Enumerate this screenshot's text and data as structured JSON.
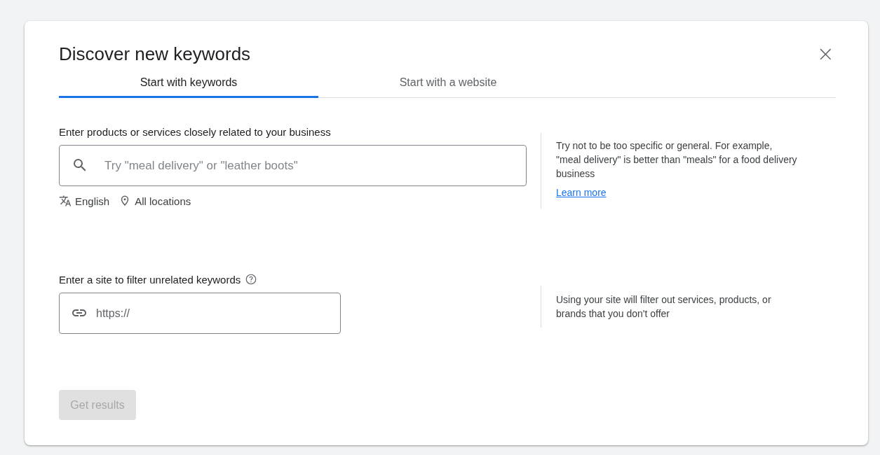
{
  "dialog": {
    "title": "Discover new keywords",
    "close": "×"
  },
  "tabs": [
    {
      "label": "Start with keywords",
      "selected": true
    },
    {
      "label": "Start with a website",
      "selected": false
    }
  ],
  "keywords_section": {
    "label": "Enter products or services closely related to your business",
    "placeholder": "Try \"meal delivery\" or \"leather boots\"",
    "language": "English",
    "location": "All locations",
    "hint": "Try not to be too specific or general. For example, \"meal delivery\" is better than \"meals\" for a food delivery business",
    "link": "Learn more"
  },
  "site_section": {
    "label": "Enter a site to filter unrelated keywords",
    "placeholder": "https://",
    "hint": "Using your site will filter out services, products, or brands that you don't offer"
  },
  "submit": {
    "label": "Get results",
    "disabled": true
  }
}
